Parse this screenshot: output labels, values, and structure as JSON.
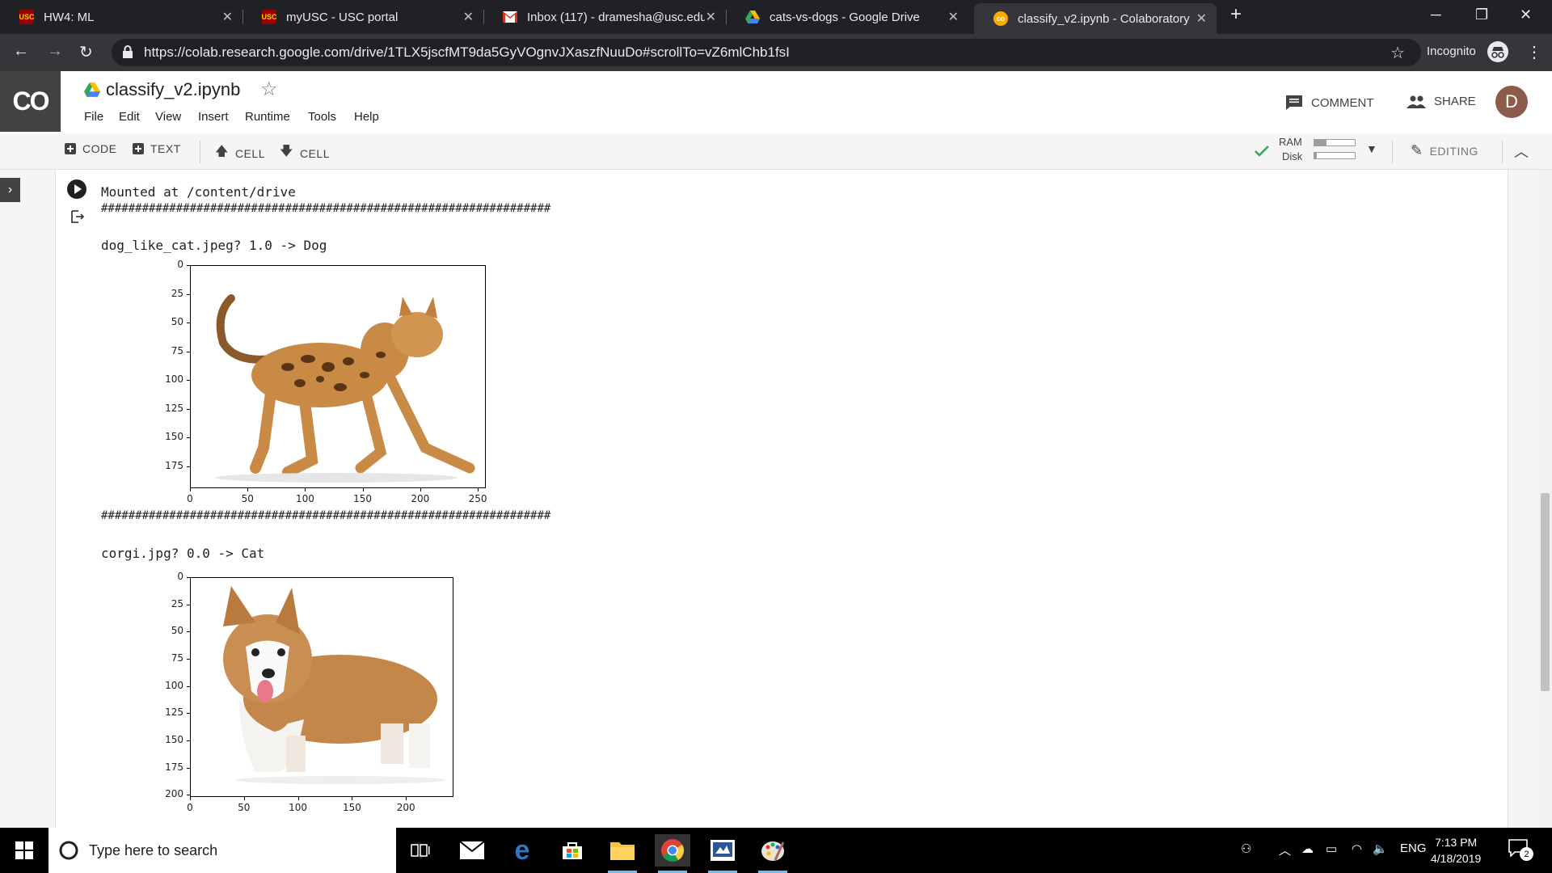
{
  "browser": {
    "tabs": [
      {
        "title": "HW4: ML",
        "favicon": "usc-icon"
      },
      {
        "title": "myUSC - USC portal",
        "favicon": "usc-icon"
      },
      {
        "title": "Inbox (117) - dramesha@usc.edu",
        "favicon": "gmail-icon"
      },
      {
        "title": "cats-vs-dogs - Google Drive",
        "favicon": "drive-icon"
      },
      {
        "title": "classify_v2.ipynb - Colaboratory",
        "favicon": "colab-icon",
        "active": true
      }
    ],
    "url": "https://colab.research.google.com/drive/1TLX5jscfMT9da5GyVOgnvJXaszfNuuDo#scrollTo=vZ6mlChb1fsI",
    "incognito_label": "Incognito"
  },
  "colab": {
    "logo": "CO",
    "notebook_title": "classify_v2.ipynb",
    "menu": [
      "File",
      "Edit",
      "View",
      "Insert",
      "Runtime",
      "Tools",
      "Help"
    ],
    "comment_label": "COMMENT",
    "share_label": "SHARE",
    "avatar_letter": "D",
    "toolbar": {
      "add_code": "CODE",
      "add_text": "TEXT",
      "cell_up": "CELL",
      "cell_down": "CELL",
      "ram_label": "RAM",
      "disk_label": "Disk",
      "ram_fraction": 0.3,
      "disk_fraction": 0.05,
      "editing_label": "EDITING"
    }
  },
  "output": {
    "mounted": "Mounted at /content/drive",
    "separator": "##################################################################",
    "results": [
      {
        "caption": "dog_like_cat.jpeg? 1.0 -> Dog",
        "image_subject": "bengal-cat",
        "y_ticks": [
          "0",
          "25",
          "50",
          "75",
          "100",
          "125",
          "150",
          "175"
        ],
        "x_ticks": [
          "0",
          "50",
          "100",
          "150",
          "200",
          "250"
        ]
      },
      {
        "caption": "corgi.jpg? 0.0 -> Cat",
        "image_subject": "corgi-dog",
        "y_ticks": [
          "0",
          "25",
          "50",
          "75",
          "100",
          "125",
          "150",
          "175",
          "200"
        ],
        "x_ticks": [
          "0",
          "50",
          "100",
          "150",
          "200"
        ]
      }
    ]
  },
  "taskbar": {
    "search_placeholder": "Type here to search",
    "language": "ENG",
    "time": "7:13 PM",
    "date": "4/18/2019",
    "notification_count": "2"
  }
}
